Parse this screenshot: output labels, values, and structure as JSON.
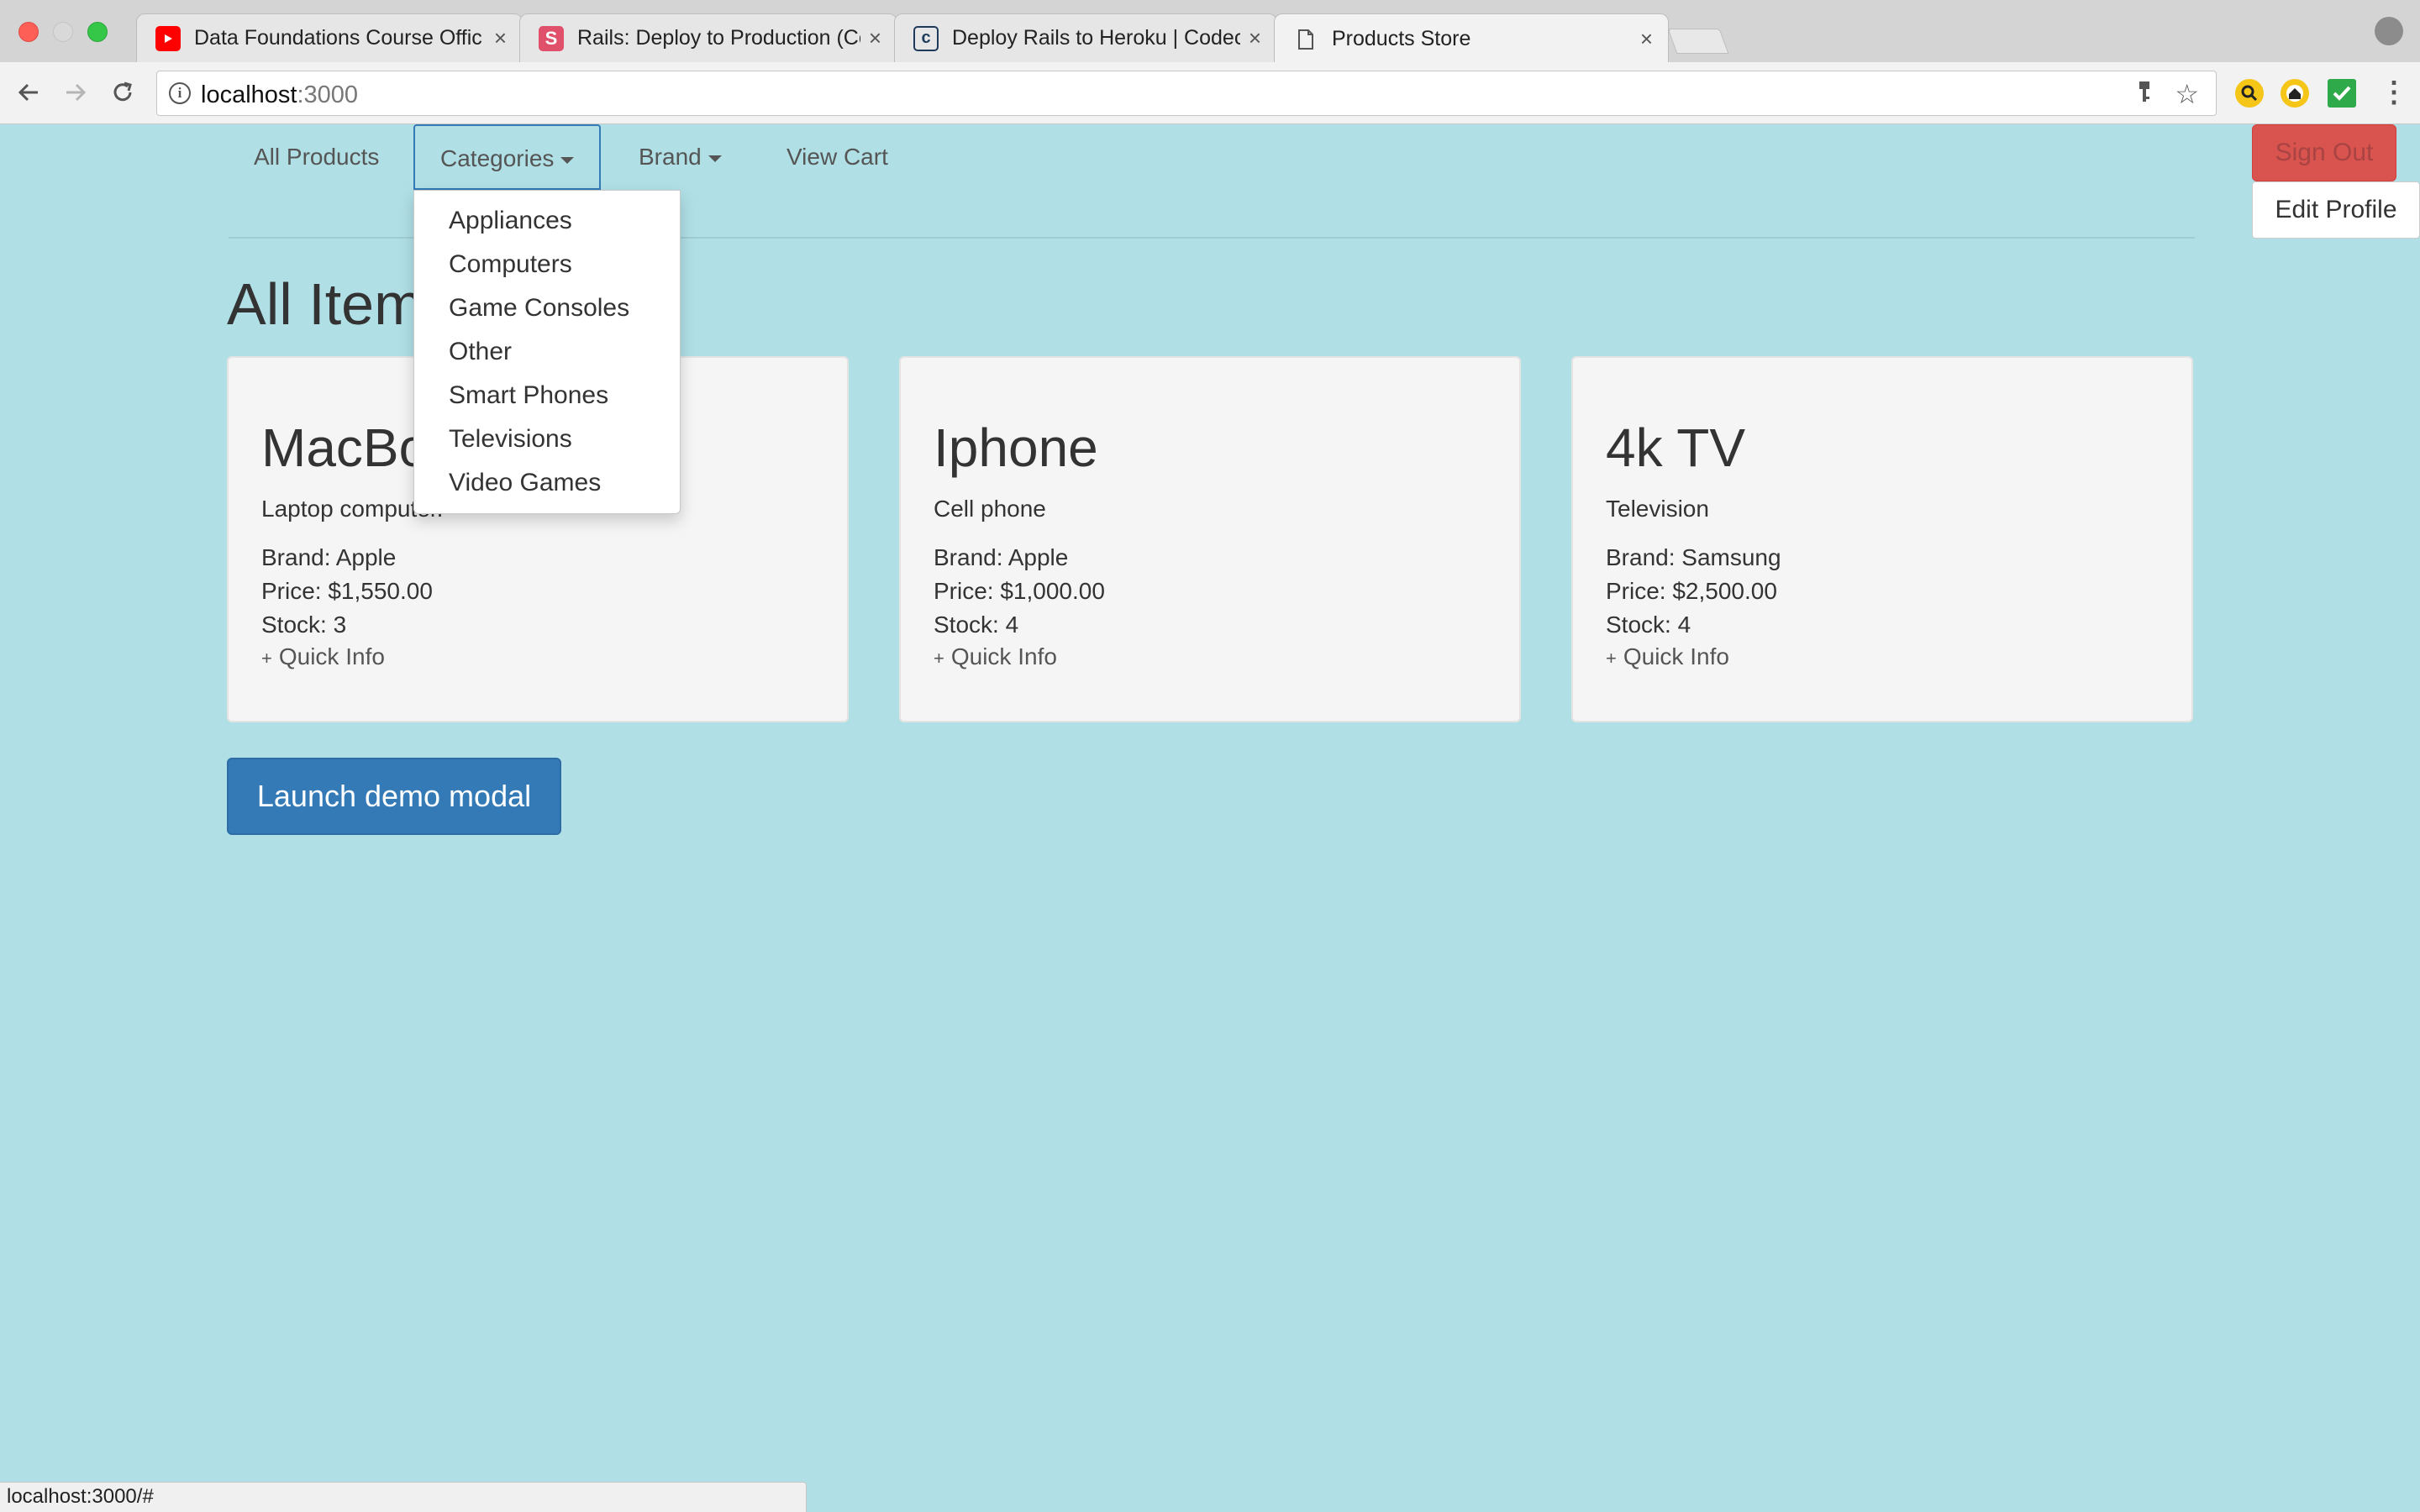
{
  "browser": {
    "tabs": [
      {
        "title": "Data Foundations Course Offic",
        "favicon": "youtube-icon",
        "favicon_color": "#ff0000"
      },
      {
        "title": "Rails: Deploy to Production (Co",
        "favicon": "s-icon",
        "favicon_color": "#e0506a",
        "favicon_text": "S"
      },
      {
        "title": "Deploy Rails to Heroku | Codec",
        "favicon": "codecademy-icon",
        "favicon_text": "c"
      },
      {
        "title": "Products Store",
        "favicon": "document-icon"
      }
    ],
    "close_symbol": "×",
    "url_host": "localhost",
    "url_port": ":3000",
    "status_url": "localhost:3000/#"
  },
  "nav": {
    "items": [
      {
        "label": "All Products"
      },
      {
        "label": "Categories"
      },
      {
        "label": "Brand"
      },
      {
        "label": "View Cart"
      }
    ],
    "categories_dropdown": [
      "Appliances",
      "Computers",
      "Game Consoles",
      "Other",
      "Smart Phones",
      "Televisions",
      "Video Games"
    ],
    "sign_out": "Sign Out",
    "edit_profile": "Edit Profile"
  },
  "main": {
    "title": "All Items",
    "products": [
      {
        "name": "MacBook",
        "description": "Laptop computer.",
        "brand": "Brand: Apple",
        "price": "Price: $1,550.00",
        "stock": "Stock: 3",
        "quick_info": "Quick Info"
      },
      {
        "name": "Iphone",
        "description": "Cell phone",
        "brand": "Brand: Apple",
        "price": "Price: $1,000.00",
        "stock": "Stock: 4",
        "quick_info": "Quick Info"
      },
      {
        "name": "4k TV",
        "description": "Television",
        "brand": "Brand: Samsung",
        "price": "Price: $2,500.00",
        "stock": "Stock: 4",
        "quick_info": "Quick Info"
      }
    ],
    "modal_button": "Launch demo modal"
  },
  "colors": {
    "page_background": "#b0e0e6",
    "primary": "#337ab7",
    "danger": "#d9534f"
  }
}
